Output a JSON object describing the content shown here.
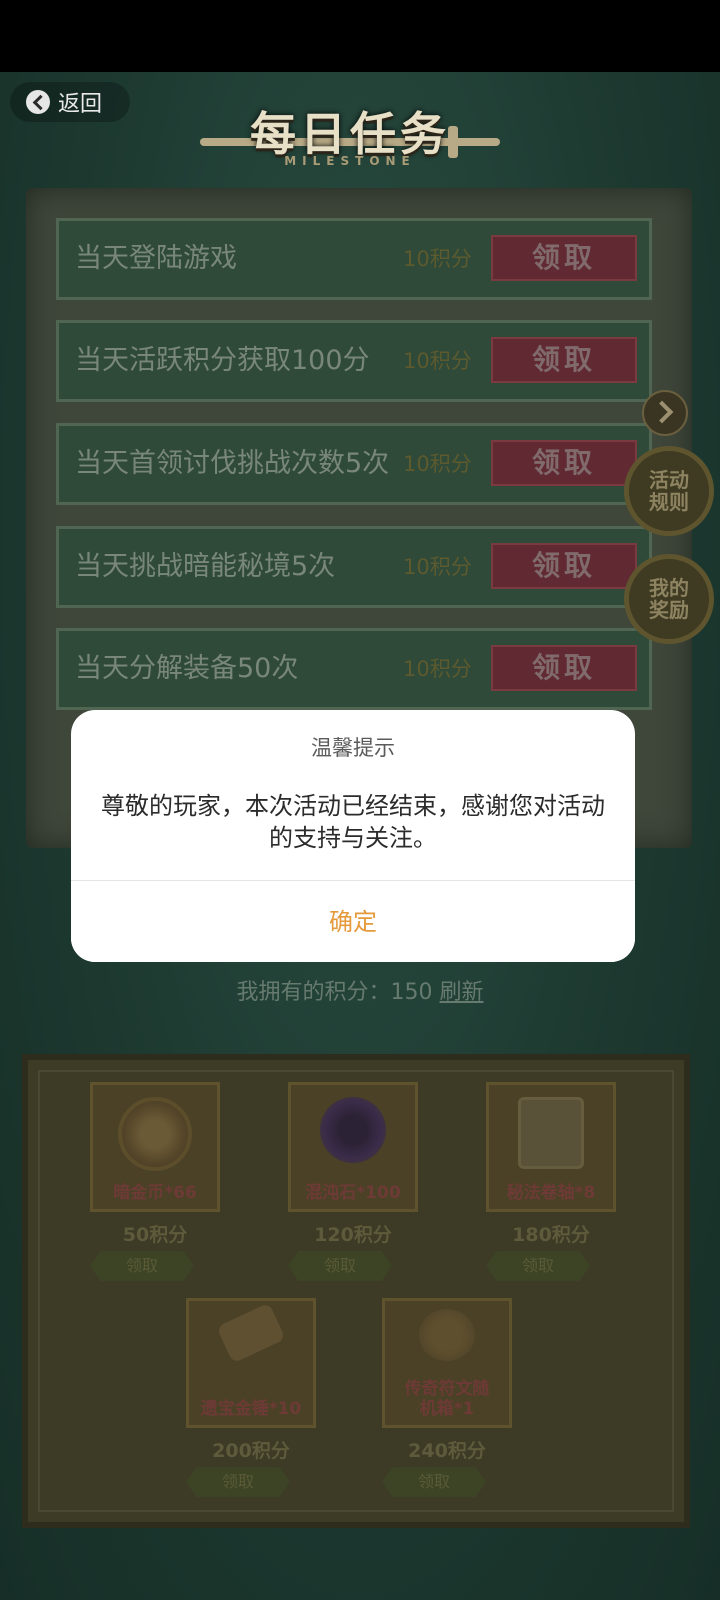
{
  "header": {
    "back_label": "返回",
    "title": "每日任务",
    "subtitle": "MILESTONE"
  },
  "tasks": [
    {
      "name": "当天登陆游戏",
      "points": "10积分",
      "button": "领取"
    },
    {
      "name": "当天活跃积分获取100分",
      "points": "10积分",
      "button": "领取"
    },
    {
      "name": "当天首领讨伐挑战次数5次",
      "points": "10积分",
      "button": "领取"
    },
    {
      "name": "当天挑战暗能秘境5次",
      "points": "10积分",
      "button": "领取"
    },
    {
      "name": "当天分解装备50次",
      "points": "10积分",
      "button": "领取"
    }
  ],
  "side": {
    "rules_label": "活动规则",
    "my_rewards_label": "我的奖励"
  },
  "points_bar": {
    "prefix": "我拥有的积分：",
    "value": "150",
    "refresh": "刷新"
  },
  "rewards": [
    {
      "name": "暗金币*66",
      "cost": "50积分",
      "button": "领取",
      "icon": "skull-coin-icon"
    },
    {
      "name": "混沌石*100",
      "cost": "120积分",
      "button": "领取",
      "icon": "chaos-flame-icon"
    },
    {
      "name": "秘法卷轴*8",
      "cost": "180积分",
      "button": "领取",
      "icon": "scroll-icon"
    },
    {
      "name": "遗宝金锤*10",
      "cost": "200积分",
      "button": "领取",
      "icon": "golden-hammer-icon"
    },
    {
      "name": "传奇符文随机箱*1",
      "cost": "240积分",
      "button": "领取",
      "icon": "rune-bag-icon"
    }
  ],
  "dialog": {
    "title": "温馨提示",
    "message": "尊敬的玩家，本次活动已经结束，感谢您对活动的支持与关注。",
    "confirm": "确定"
  },
  "colors": {
    "dialog_confirm": "#e59a3c",
    "claim_button": "#612a33",
    "backdrop": "#1e3a31"
  }
}
